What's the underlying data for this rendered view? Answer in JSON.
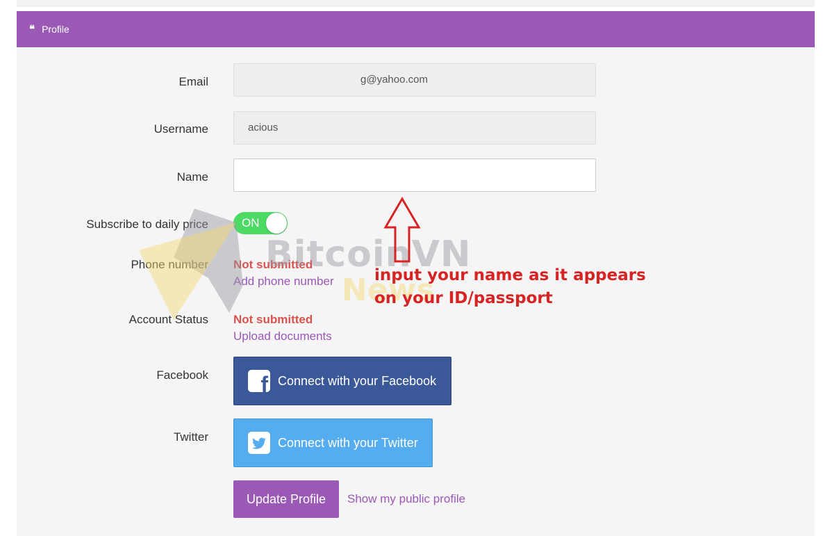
{
  "header": {
    "title": "Profile",
    "icon": "quote-icon"
  },
  "form": {
    "email_label": "Email",
    "email_value": "g@yahoo.com",
    "username_label": "Username",
    "username_value": "acious",
    "name_label": "Name",
    "name_value": "",
    "subscribe_label": "Subscribe to daily price",
    "subscribe_state": "ON",
    "phone_label": "Phone number",
    "phone_status": "Not submitted",
    "phone_link": "Add phone number",
    "account_label": "Account Status",
    "account_status": "Not submitted",
    "account_link": "Upload documents",
    "facebook_label": "Facebook",
    "facebook_button": "Connect with your Facebook",
    "twitter_label": "Twitter",
    "twitter_button": "Connect with your Twitter",
    "update_button": "Update Profile",
    "public_profile_link": "Show my public profile"
  },
  "watermark": {
    "line1": "BitcoinVN",
    "line2": "News"
  },
  "annotation": {
    "line1": "input your name as it appears",
    "line2": "on your ID/passport",
    "color": "#d62424"
  },
  "colors": {
    "accent": "#9b59b6",
    "danger": "#d9534f",
    "toggle_on": "#4cd964",
    "facebook": "#3b5998",
    "twitter": "#55acee"
  }
}
